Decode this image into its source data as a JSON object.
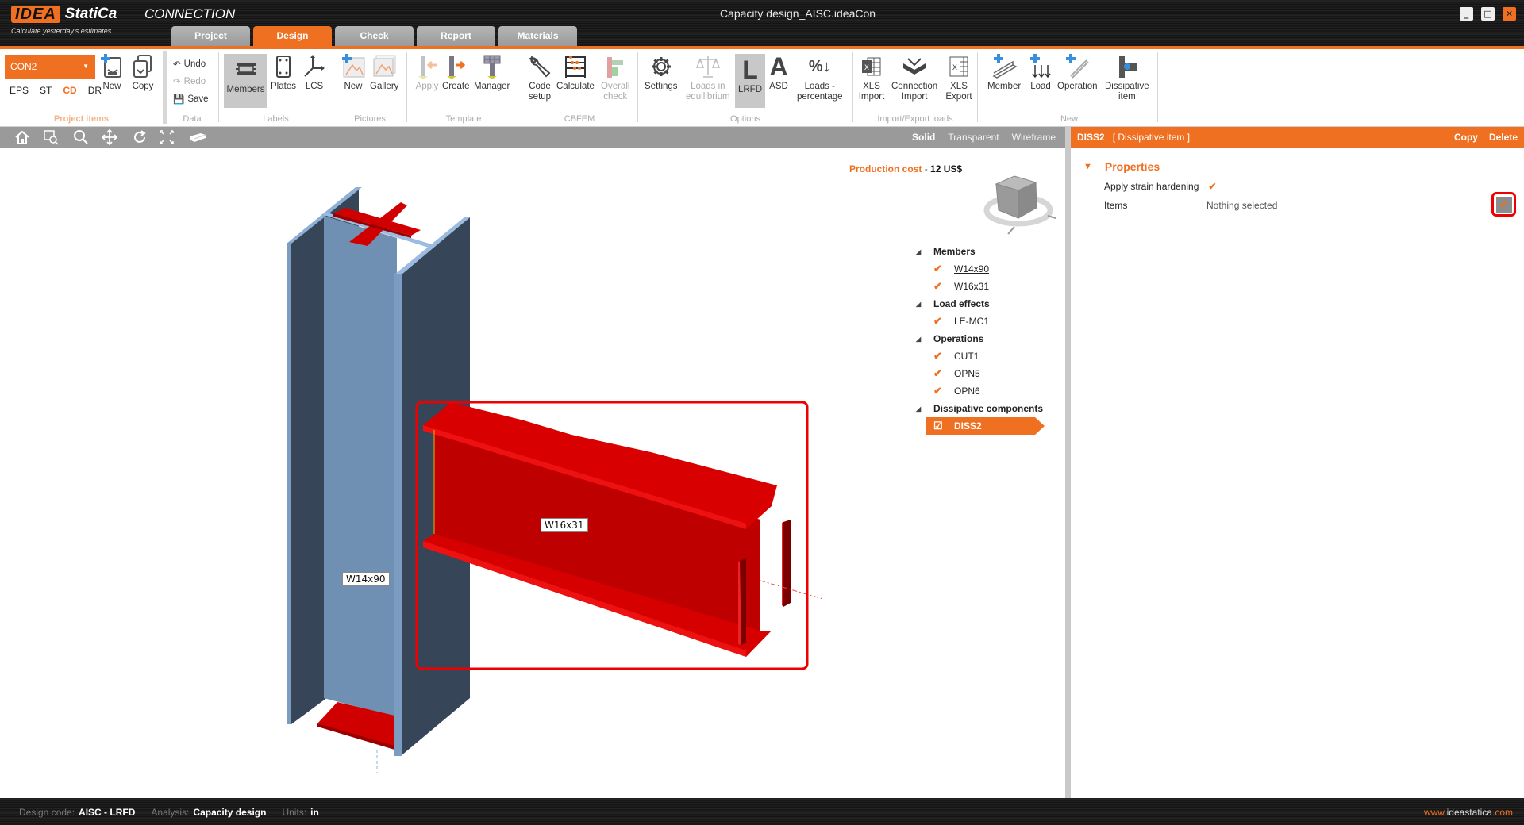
{
  "app": {
    "logo_brand": "IDEA",
    "logo_name": "StatiCa",
    "product": "CONNECTION",
    "tagline": "Calculate yesterday's estimates",
    "window_title": "Capacity design_AISC.ideaCon",
    "window_controls": {
      "minimize": "_",
      "maximize": "□",
      "close": "✕"
    }
  },
  "tabs": [
    {
      "label": "Project",
      "active": false
    },
    {
      "label": "Design",
      "active": true
    },
    {
      "label": "Check",
      "active": false
    },
    {
      "label": "Report",
      "active": false
    },
    {
      "label": "Materials",
      "active": false
    }
  ],
  "ribbon": {
    "project_items": {
      "label": "Project items",
      "connection_select": "CON2",
      "modes": [
        "EPS",
        "ST",
        "CD",
        "DR"
      ],
      "active_mode": "CD",
      "new_label": "New",
      "copy_label": "Copy"
    },
    "data": {
      "label": "Data",
      "undo": "Undo",
      "redo": "Redo",
      "save": "Save"
    },
    "labels": {
      "label": "Labels",
      "members": "Members",
      "plates": "Plates",
      "lcs": "LCS"
    },
    "pictures": {
      "label": "Pictures",
      "new": "New",
      "gallery": "Gallery"
    },
    "template": {
      "label": "Template",
      "apply": "Apply",
      "create": "Create",
      "manager": "Manager"
    },
    "cbfem": {
      "label": "CBFEM",
      "code_setup_1": "Code",
      "code_setup_2": "setup",
      "calculate": "Calculate",
      "overall_1": "Overall",
      "overall_2": "check"
    },
    "options": {
      "label": "Options",
      "settings": "Settings",
      "loads_eq_1": "Loads in",
      "loads_eq_2": "equilibrium",
      "lrfd": "LRFD",
      "asd": "ASD",
      "loads_pct_1": "Loads -",
      "loads_pct_2": "percentage"
    },
    "import_export": {
      "label": "Import/Export loads",
      "xls_import_1": "XLS",
      "xls_import_2": "Import",
      "conn_import_1": "Connection",
      "conn_import_2": "Import",
      "xls_export_1": "XLS",
      "xls_export_2": "Export"
    },
    "new": {
      "label": "New",
      "member": "Member",
      "load": "Load",
      "operation": "Operation",
      "dissipative_1": "Dissipative",
      "dissipative_2": "item"
    }
  },
  "viewbar": {
    "icons": [
      "home-icon",
      "zoom-window-icon",
      "zoom-icon",
      "pan-icon",
      "rotate-icon",
      "zoom-extents-icon",
      "view-3d-icon"
    ],
    "modes": [
      "Solid",
      "Transparent",
      "Wireframe"
    ],
    "active_mode": "Solid"
  },
  "viewport": {
    "production_cost_label": "Production cost",
    "production_cost_sep": "-",
    "production_cost_value": "12 US$",
    "member_labels": {
      "column": "W14x90",
      "beam": "W16x31"
    },
    "colors": {
      "column": "#6f8fb3",
      "column_dark": "#374559",
      "dissipative": "#d10000",
      "highlight": "#ee0000"
    }
  },
  "tree": {
    "groups": [
      {
        "label": "Members",
        "items": [
          {
            "label": "W14x90",
            "checked": true,
            "link": true
          },
          {
            "label": "W16x31",
            "checked": true
          }
        ]
      },
      {
        "label": "Load effects",
        "items": [
          {
            "label": "LE-MC1",
            "checked": true
          }
        ]
      },
      {
        "label": "Operations",
        "items": [
          {
            "label": "CUT1",
            "checked": true
          },
          {
            "label": "OPN5",
            "checked": true
          },
          {
            "label": "OPN6",
            "checked": true
          }
        ]
      },
      {
        "label": "Dissipative components",
        "items": [
          {
            "label": "DISS2",
            "checked": true,
            "selected": true
          }
        ]
      }
    ]
  },
  "panel": {
    "header_name": "DISS2",
    "header_type": "[ Dissipative item ]",
    "copy": "Copy",
    "delete": "Delete",
    "section_title": "Properties",
    "strain_hardening_label": "Apply strain hardening",
    "strain_hardening_checked": true,
    "items_label": "Items",
    "items_value": "Nothing selected"
  },
  "status": {
    "design_code_label": "Design code:",
    "design_code_value": "AISC - LRFD",
    "analysis_label": "Analysis:",
    "analysis_value": "Capacity design",
    "units_label": "Units:",
    "units_value": "in",
    "website_prefix": "www.",
    "website_main": "ideastatica",
    "website_suffix": ".com"
  },
  "accent_color": "#f07022"
}
